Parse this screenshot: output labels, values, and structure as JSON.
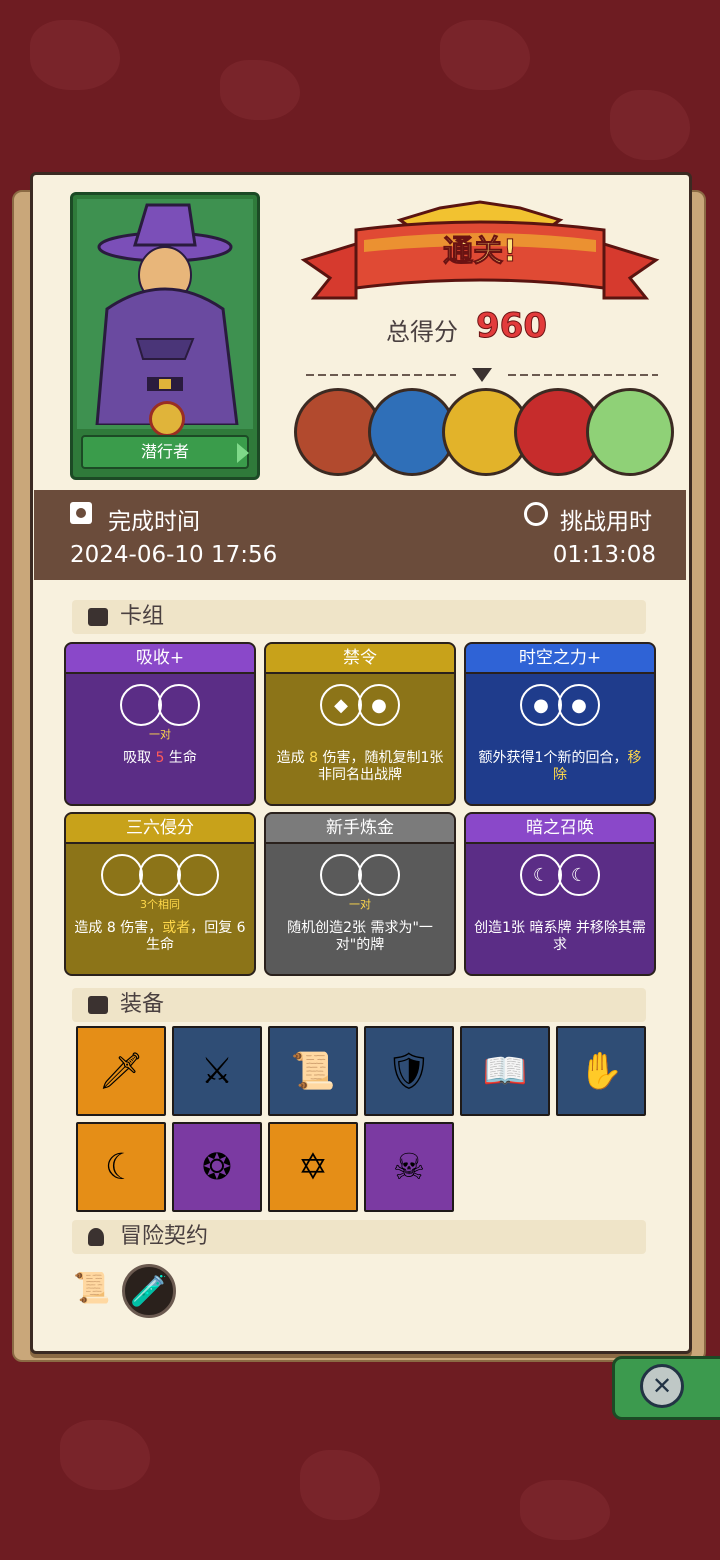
{
  "colors": {
    "background": "#6e1c22",
    "panel": "#f8f1de",
    "band": "#6b4c3b",
    "score_red": "#e23b3b",
    "card_purple": "#5b2d86",
    "card_olive": "#8c7418",
    "card_blue": "#1f3c8c",
    "card_gray": "#5a5a5a"
  },
  "hero": {
    "name": "潜行者",
    "icon": "cloaked-rogue-portrait"
  },
  "result": {
    "banner": "通关!",
    "score_label": "总得分",
    "score_value": "960"
  },
  "bosses": [
    {
      "icon": "red-orb-monster-icon",
      "color": "#b24a2e"
    },
    {
      "icon": "blue-king-icon",
      "color": "#2f6fb8"
    },
    {
      "icon": "golden-mask-icon",
      "color": "#e2b32a"
    },
    {
      "icon": "red-hat-demon-icon",
      "color": "#c62c2c"
    },
    {
      "icon": "green-elf-icon",
      "color": "#8fd177"
    }
  ],
  "info": {
    "finish_time_label": "完成时间",
    "finish_time_value": "2024-06-10 17:56",
    "challenge_time_label": "挑战用时",
    "challenge_time_value": "01:13:08"
  },
  "deck": {
    "title": "卡组",
    "cards": [
      {
        "name": "吸收+",
        "req": "一对",
        "desc_pre": "吸取 ",
        "desc_hl": "5",
        "desc_post": " 生命",
        "color": "purple",
        "dice": [
          "",
          ""
        ]
      },
      {
        "name": "禁令",
        "req": "",
        "desc_pre": "造成 ",
        "desc_hl": "8",
        "desc_post": " 伤害，随机复制1张非同名出战牌",
        "color": "olive",
        "dice": [
          "◆",
          "●"
        ]
      },
      {
        "name": "时空之力+",
        "req": "",
        "desc_pre": "额外获得1个新的回合，",
        "desc_hl": "移除",
        "desc_post": "",
        "color": "blue",
        "dice": [
          "●",
          "●"
        ]
      },
      {
        "name": "三六侵分",
        "req": "3个相同",
        "desc_pre": "造成 8 伤害，",
        "desc_hl": "或者",
        "desc_post": "，回复 6 生命",
        "color": "olive",
        "dice": [
          "",
          "",
          ""
        ]
      },
      {
        "name": "新手炼金",
        "req": "一对",
        "desc_pre": "随机创造2张 需求为\"一对\"的牌",
        "desc_hl": "",
        "desc_post": "",
        "color": "gray",
        "dice": [
          "",
          ""
        ]
      },
      {
        "name": "暗之召唤",
        "req": "",
        "desc_pre": "创造1张 暗系牌 并移除其需求",
        "desc_hl": "",
        "desc_post": "",
        "color": "purple",
        "dice": [
          "☾",
          "☾"
        ]
      }
    ]
  },
  "equipment": {
    "title": "装备",
    "items": [
      {
        "icon": "crystal-dagger-icon",
        "glyph": "🗡",
        "bg": "orange"
      },
      {
        "icon": "scythe-icon",
        "glyph": "⚔",
        "bg": "blue"
      },
      {
        "icon": "scroll-icon",
        "glyph": "📜",
        "bg": "blue"
      },
      {
        "icon": "red-shield-icon",
        "glyph": "🛡",
        "bg": "blue"
      },
      {
        "icon": "skull-book-icon",
        "glyph": "📖",
        "bg": "blue"
      },
      {
        "icon": "gauntlet-icon",
        "glyph": "✋",
        "bg": "blue"
      },
      {
        "icon": "moon-gem-icon",
        "glyph": "☾",
        "bg": "orange"
      },
      {
        "icon": "leaf-ring-icon",
        "glyph": "❂",
        "bg": "purple"
      },
      {
        "icon": "star-pendant-icon",
        "glyph": "✡",
        "bg": "orange"
      },
      {
        "icon": "demon-mask-icon",
        "glyph": "☠",
        "bg": "purple"
      }
    ]
  },
  "contract": {
    "title": "冒险契约",
    "items": [
      {
        "icon": "scroll-contract-icon",
        "glyph": "📜"
      },
      {
        "icon": "potion-bottle-icon",
        "glyph": "🧪"
      }
    ]
  },
  "close": {
    "icon": "close-icon",
    "glyph": "✕"
  }
}
